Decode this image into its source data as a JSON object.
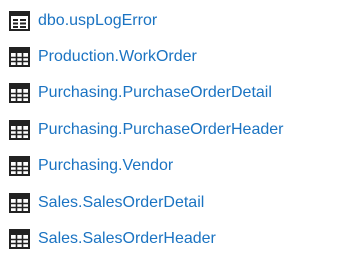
{
  "items": [
    {
      "label": "dbo.uspLogError",
      "icon": "stored-procedure-icon"
    },
    {
      "label": "Production.WorkOrder",
      "icon": "table-icon"
    },
    {
      "label": "Purchasing.PurchaseOrderDetail",
      "icon": "table-icon"
    },
    {
      "label": "Purchasing.PurchaseOrderHeader",
      "icon": "table-icon"
    },
    {
      "label": "Purchasing.Vendor",
      "icon": "table-icon"
    },
    {
      "label": "Sales.SalesOrderDetail",
      "icon": "table-icon"
    },
    {
      "label": "Sales.SalesOrderHeader",
      "icon": "table-icon"
    }
  ],
  "colors": {
    "link": "#1a73c2",
    "icon_dark": "#222222"
  }
}
